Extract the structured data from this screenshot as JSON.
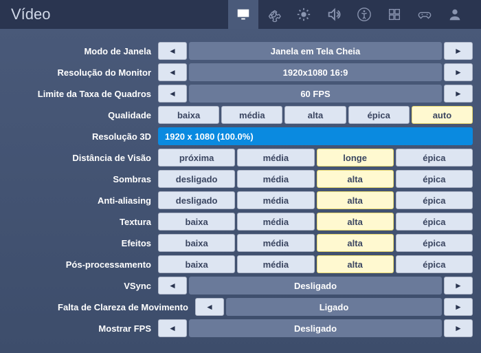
{
  "header": {
    "title": "Vídeo"
  },
  "tabs": [
    {
      "name": "video",
      "active": true
    },
    {
      "name": "general",
      "active": false
    },
    {
      "name": "brightness",
      "active": false
    },
    {
      "name": "audio",
      "active": false
    },
    {
      "name": "accessibility",
      "active": false
    },
    {
      "name": "input",
      "active": false
    },
    {
      "name": "controller",
      "active": false
    },
    {
      "name": "account",
      "active": false
    }
  ],
  "rows": {
    "windowMode": {
      "label": "Modo de Janela",
      "value": "Janela em Tela Cheia"
    },
    "monitorRes": {
      "label": "Resolução do Monitor",
      "value": "1920x1080 16:9"
    },
    "frameLimit": {
      "label": "Limite da Taxa de Quadros",
      "value": "60 FPS"
    },
    "quality": {
      "label": "Qualidade",
      "options": [
        "baixa",
        "média",
        "alta",
        "épica",
        "auto"
      ],
      "selected": 4
    },
    "res3d": {
      "label": "Resolução 3D",
      "value": "1920 x 1080 (100.0%)"
    },
    "viewDist": {
      "label": "Distância de Visão",
      "options": [
        "próxima",
        "média",
        "longe",
        "épica"
      ],
      "selected": 2
    },
    "shadows": {
      "label": "Sombras",
      "options": [
        "desligado",
        "média",
        "alta",
        "épica"
      ],
      "selected": 2
    },
    "aa": {
      "label": "Anti-aliasing",
      "options": [
        "desligado",
        "média",
        "alta",
        "épica"
      ],
      "selected": 2
    },
    "texture": {
      "label": "Textura",
      "options": [
        "baixa",
        "média",
        "alta",
        "épica"
      ],
      "selected": 2
    },
    "effects": {
      "label": "Efeitos",
      "options": [
        "baixa",
        "média",
        "alta",
        "épica"
      ],
      "selected": 2
    },
    "postproc": {
      "label": "Pós-processamento",
      "options": [
        "baixa",
        "média",
        "alta",
        "épica"
      ],
      "selected": 2
    },
    "vsync": {
      "label": "VSync",
      "value": "Desligado"
    },
    "motionBlur": {
      "label": "Falta de Clareza de Movimento",
      "value": "Ligado"
    },
    "showFps": {
      "label": "Mostrar FPS",
      "value": "Desligado"
    }
  }
}
